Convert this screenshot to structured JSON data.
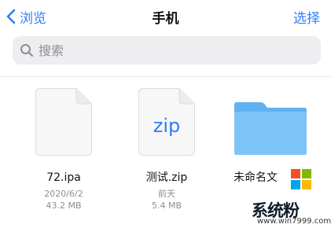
{
  "navbar": {
    "back_label": "浏览",
    "title": "手机",
    "select_label": "选择"
  },
  "search": {
    "placeholder": "搜索"
  },
  "files": [
    {
      "name": "72.ipa",
      "date": "2020/6/2",
      "size": "43.2 MB",
      "icon": "document-icon"
    },
    {
      "name": "测试.zip",
      "date": "前天",
      "size": "5.4 MB",
      "icon": "zip-document-icon",
      "icon_text": "zip"
    },
    {
      "name": "未命名文",
      "icon": "folder-icon"
    }
  ],
  "watermark": {
    "title": "系统粉",
    "url": "www.win7999.com",
    "logo_colors": [
      "#f25022",
      "#7fba00",
      "#00a4ef",
      "#ffb900"
    ]
  },
  "colors": {
    "accent": "#2f7cf6",
    "folder": "#6cbaf5",
    "search_bg": "#eeeef0"
  }
}
